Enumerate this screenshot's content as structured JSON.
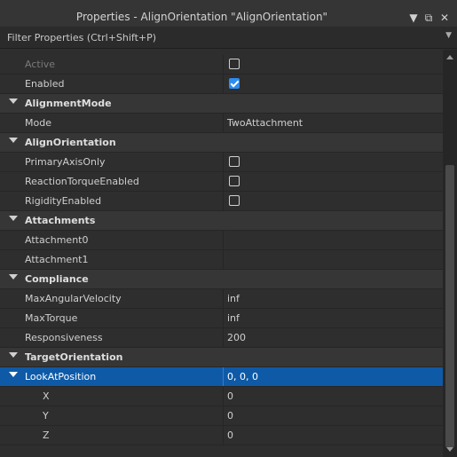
{
  "window": {
    "title": "Properties - AlignOrientation \"AlignOrientation\"",
    "icons": [
      "chevron-down-icon",
      "float-window-icon",
      "close-icon"
    ]
  },
  "filter": {
    "placeholder": "Filter Properties (Ctrl+Shift+P)"
  },
  "rows": {
    "active": {
      "label": "Active",
      "checked": false
    },
    "enabled": {
      "label": "Enabled",
      "checked": true
    },
    "alignmentmode": {
      "label": "AlignmentMode"
    },
    "mode": {
      "label": "Mode",
      "value": "TwoAttachment"
    },
    "alignorientation": {
      "label": "AlignOrientation"
    },
    "primaryaxisonly": {
      "label": "PrimaryAxisOnly",
      "checked": false
    },
    "reactiontorque": {
      "label": "ReactionTorqueEnabled",
      "checked": false
    },
    "rigidity": {
      "label": "RigidityEnabled",
      "checked": false
    },
    "attachments": {
      "label": "Attachments"
    },
    "attachment0": {
      "label": "Attachment0",
      "value": ""
    },
    "attachment1": {
      "label": "Attachment1",
      "value": ""
    },
    "compliance": {
      "label": "Compliance"
    },
    "maxangularvelocity": {
      "label": "MaxAngularVelocity",
      "value": "inf"
    },
    "maxtorque": {
      "label": "MaxTorque",
      "value": "inf"
    },
    "responsiveness": {
      "label": "Responsiveness",
      "value": "200"
    },
    "targetorientation": {
      "label": "TargetOrientation"
    },
    "lookatposition": {
      "label": "LookAtPosition",
      "value": "0, 0, 0"
    },
    "x": {
      "label": "X",
      "value": "0"
    },
    "y": {
      "label": "Y",
      "value": "0"
    },
    "z": {
      "label": "Z",
      "value": "0"
    }
  },
  "colors": {
    "background": "#2e2e2e",
    "category": "#363636",
    "selected": "#0e5aa7",
    "checkbox_checked": "#2d8cf0"
  }
}
